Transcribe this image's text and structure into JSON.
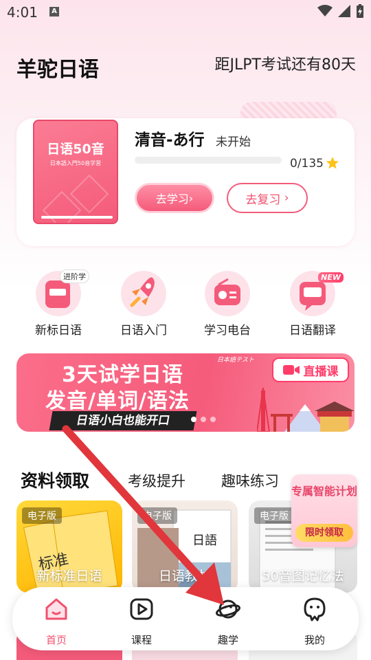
{
  "status_bar": {
    "time": "4:01",
    "notification_letter": "A"
  },
  "header": {
    "app_title": "羊驼日语",
    "countdown": "距JLPT考试还有80天"
  },
  "course_card": {
    "book_title": "日语50音",
    "book_subtitle": "日本語入門50音学習",
    "lesson_title": "清音-あ行",
    "lesson_status": "未开始",
    "progress_text": "0/135",
    "progress_fraction": 0,
    "study_button": "去学习",
    "review_button": "去复习",
    "accent_color": "#f45b7a"
  },
  "quick_nav": [
    {
      "label": "新标日语",
      "badge": "进阶学",
      "icon": "book-icon"
    },
    {
      "label": "日语入门",
      "icon": "rocket-icon"
    },
    {
      "label": "学习电台",
      "icon": "radio-icon"
    },
    {
      "label": "日语翻译",
      "badge": "NEW",
      "icon": "translate-icon"
    }
  ],
  "banner": {
    "line1": "3天试学日语",
    "line2": "发音/单词/语法",
    "line3": "日语小白也能开口",
    "tag": "日本語テスト",
    "live_label": "直播课"
  },
  "resources": {
    "tabs": [
      "资料领取",
      "考级提升",
      "趣味练习"
    ],
    "cards": [
      {
        "tag": "电子版",
        "name": "新标准日语"
      },
      {
        "tag": "电子版",
        "name": "日语教材"
      },
      {
        "tag": "电子版",
        "name": "50音图记忆法"
      }
    ],
    "promo": {
      "title": "专属智能计划",
      "button": "限时领取"
    }
  },
  "bottom_nav": [
    {
      "label": "首页",
      "icon": "home-icon",
      "active": true
    },
    {
      "label": "课程",
      "icon": "play-icon",
      "active": false
    },
    {
      "label": "趣学",
      "icon": "planet-icon",
      "active": false
    },
    {
      "label": "我的",
      "icon": "profile-icon",
      "active": false
    }
  ]
}
